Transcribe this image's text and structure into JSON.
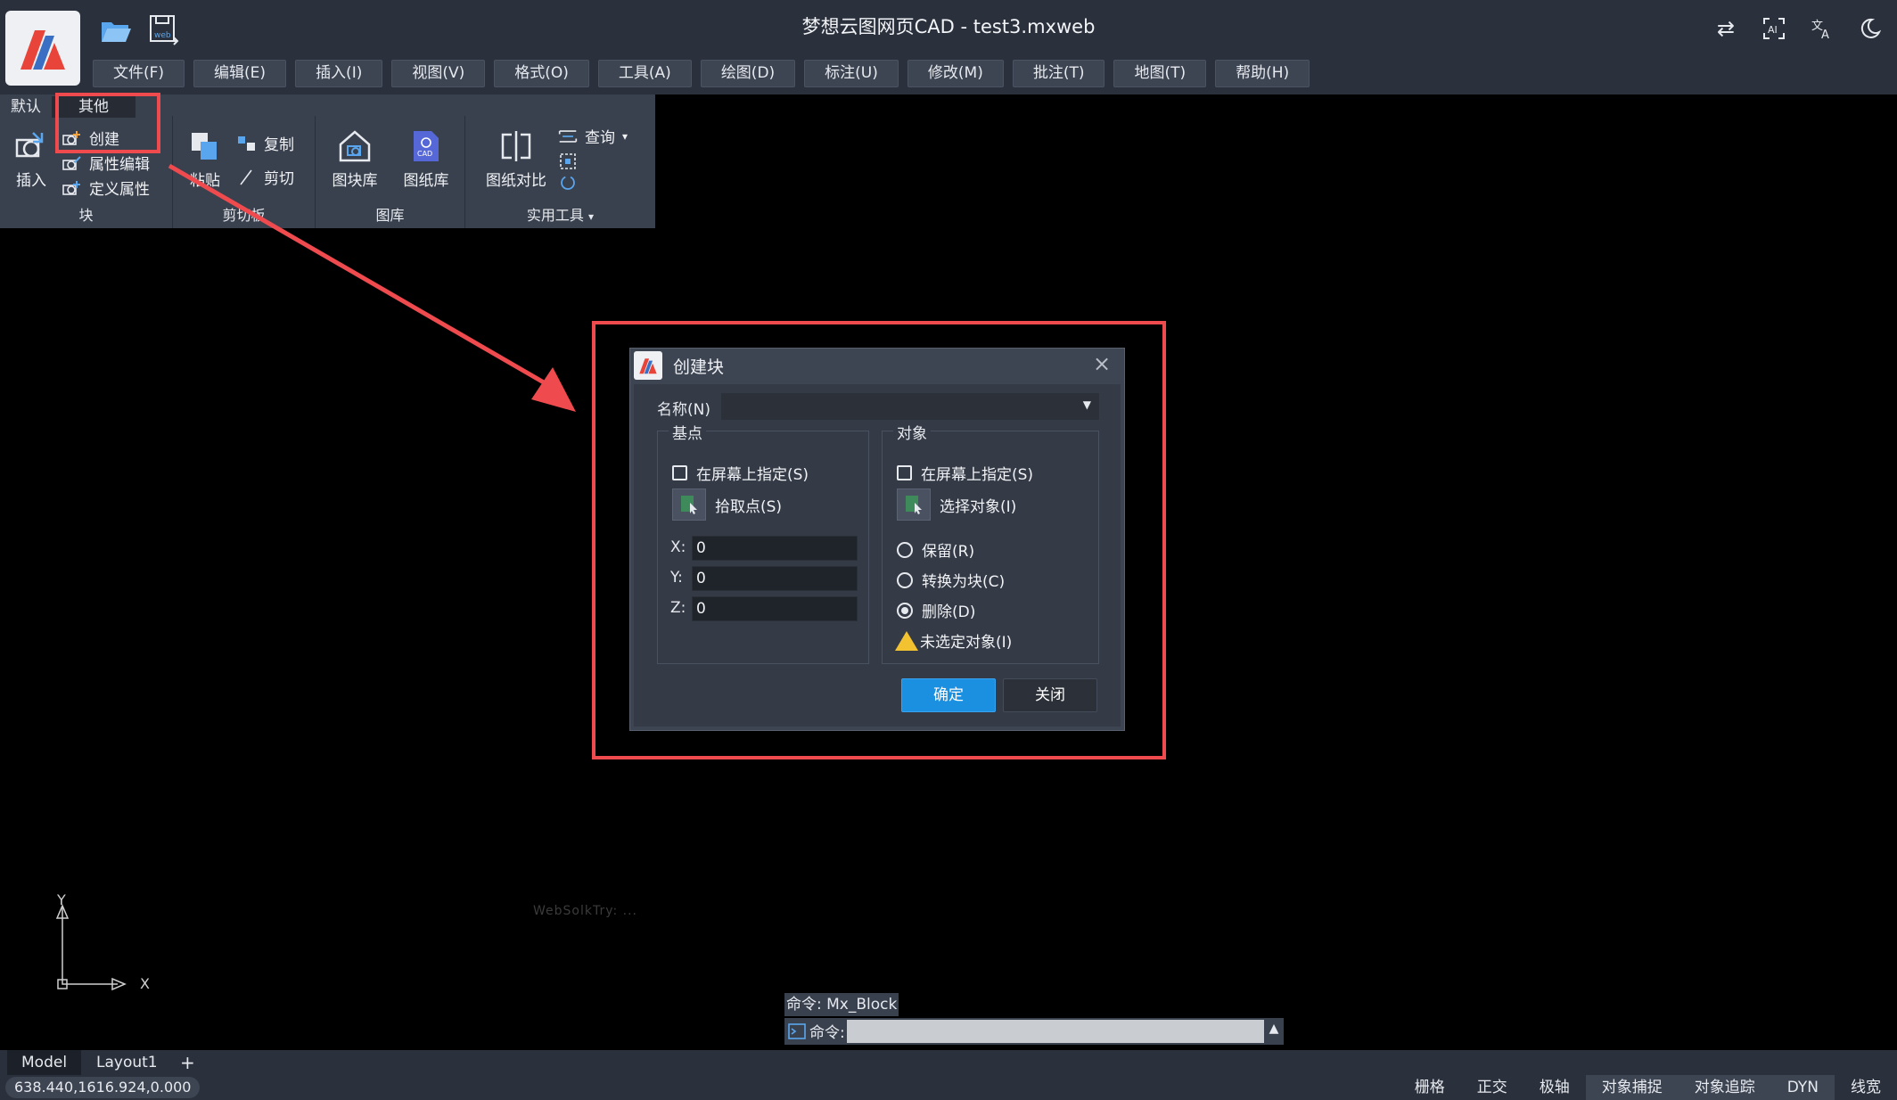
{
  "window": {
    "title": "梦想云图网页CAD - test3.mxweb"
  },
  "menu": [
    {
      "label": "文件(F)"
    },
    {
      "label": "编辑(E)"
    },
    {
      "label": "插入(I)"
    },
    {
      "label": "视图(V)"
    },
    {
      "label": "格式(O)"
    },
    {
      "label": "工具(A)"
    },
    {
      "label": "绘图(D)"
    },
    {
      "label": "标注(U)"
    },
    {
      "label": "修改(M)"
    },
    {
      "label": "批注(T)"
    },
    {
      "label": "地图(T)"
    },
    {
      "label": "帮助(H)"
    }
  ],
  "ribbon": {
    "tabs": [
      {
        "label": "默认"
      },
      {
        "label": "其他"
      }
    ],
    "groups": {
      "block": {
        "label": "块",
        "insert": "插入",
        "create": "创建",
        "attr_edit": "属性编辑",
        "define_attr": "定义属性"
      },
      "clipboard": {
        "label": "剪切板",
        "paste": "粘贴",
        "copy": "复制",
        "cut": "剪切"
      },
      "library": {
        "label": "图库",
        "block_lib": "图块库",
        "drawing_lib": "图纸库"
      },
      "tools": {
        "label": "实用工具",
        "compare": "图纸对比",
        "query": "查询"
      }
    }
  },
  "dialog": {
    "title": "创建块",
    "name_label": "名称(N)",
    "name_value": "",
    "basepoint": {
      "legend": "基点",
      "on_screen": "在屏幕上指定(S)",
      "pick_point": "拾取点(S)",
      "x_label": "X:",
      "x": "0",
      "y_label": "Y:",
      "y": "0",
      "z_label": "Z:",
      "z": "0"
    },
    "objects": {
      "legend": "对象",
      "on_screen": "在屏幕上指定(S)",
      "select": "选择对象(I)",
      "retain": "保留(R)",
      "convert": "转换为块(C)",
      "delete": "删除(D)",
      "selected_option": "删除(D)",
      "warning": "未选定对象(I)"
    },
    "ok": "确定",
    "close": "关闭"
  },
  "canvas": {
    "watermark": "WebSolkTry: ...",
    "axis_y": "Y",
    "axis_x": "X"
  },
  "command": {
    "history": "命令: Mx_Block",
    "prompt": "命令:",
    "input": ""
  },
  "layouts": [
    {
      "label": "Model"
    },
    {
      "label": "Layout1"
    }
  ],
  "add_layout": "+",
  "status": {
    "coords": "638.440,1616.924,0.000",
    "toggles": [
      {
        "label": "栅格",
        "on": false
      },
      {
        "label": "正交",
        "on": false
      },
      {
        "label": "极轴",
        "on": false
      },
      {
        "label": "对象捕捉",
        "on": true
      },
      {
        "label": "对象追踪",
        "on": true
      },
      {
        "label": "DYN",
        "on": true
      },
      {
        "label": "线宽",
        "on": false
      }
    ]
  },
  "colors": {
    "highlight": "#ef4b4f",
    "accent": "#1b8fe0",
    "warning": "#f2c230"
  }
}
